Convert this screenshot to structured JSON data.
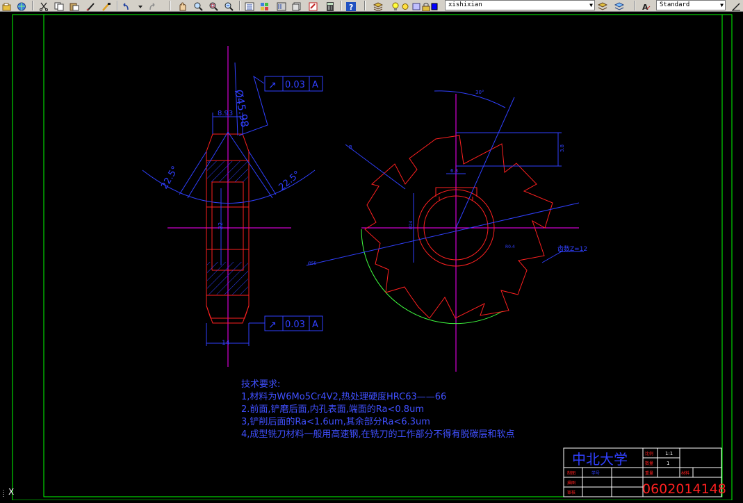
{
  "toolbar": {
    "layer_combo_value": "xishixian",
    "style_combo_value": "Standard",
    "icons": [
      "open-icon",
      "globe-icon",
      "cut-icon",
      "copy-icon",
      "paste-icon",
      "brush-icon",
      "match-icon",
      "undo-icon",
      "redo-icon",
      "pan-icon",
      "zoom-icon",
      "zoom-window-icon",
      "zoom-previous-icon",
      "properties-icon",
      "design-center-icon",
      "tool-palette-icon",
      "sheet-set-icon",
      "markup-icon",
      "calculator-icon",
      "help-icon",
      "layer-manager-icon",
      "bulb-icon",
      "sun-icon",
      "freeze-icon",
      "lock-icon",
      "color-swatch",
      "layer-previous-icon",
      "layer-state-icon",
      "text-style-icon",
      "dim-style-icon"
    ]
  },
  "drawing": {
    "dim_diameter": "Ø45.98",
    "dim_width_top": "8.93",
    "dim_angle_left": "22.5°",
    "dim_angle_right": "22.5°",
    "dim_bore": "22",
    "dim_width_bottom": "14",
    "gdt_top_symbol": "↗",
    "gdt_top_value": "0.03",
    "gdt_top_datum": "A",
    "gdt_bottom_symbol": "↗",
    "gdt_bottom_value": "0.03",
    "gdt_bottom_datum": "A",
    "dim_arc_angle": "30°",
    "dim_height_right": "3.8",
    "dim_leader_left": "R",
    "dim_keyway": "6.3",
    "dim_inner": "Ø24",
    "dim_outer": "Ø55",
    "dim_tooth_angle": "R0.4",
    "teeth_label": "齿数Z=12"
  },
  "tech_requirements": {
    "title": "技术要求:",
    "line1": "1,材料为W6Mo5Cr4V2,热处理硬度HRC63——66",
    "line2": "2.前面,铲磨后面,内孔表面,端面的Ra<0.8um",
    "line3": "3,铲削后面的Ra<1.6um,其余部分Ra<6.3um",
    "line4": "4,成型铣刀材料一般用高速钢,在铣刀的工作部分不得有脱碳层和软点"
  },
  "title_block": {
    "university": "中北大学",
    "ratio_label": "比例",
    "ratio_value": "1:1",
    "qty_label": "数量",
    "qty_value": "1",
    "weight_label": "重量",
    "material_label": "材料",
    "drawn_label": "制图",
    "drawn_name": "学号",
    "checked_label": "描图",
    "reviewed_label": "审核",
    "student_id": "0602014148"
  },
  "command_line": {
    "ucs_icon": "X"
  },
  "colors": {
    "frame": "#00ff00",
    "red": "#ff2020",
    "blue": "#3040ff",
    "magenta": "#ff00ff",
    "text_blue": "#4050ff",
    "title_red": "#ff2020"
  }
}
